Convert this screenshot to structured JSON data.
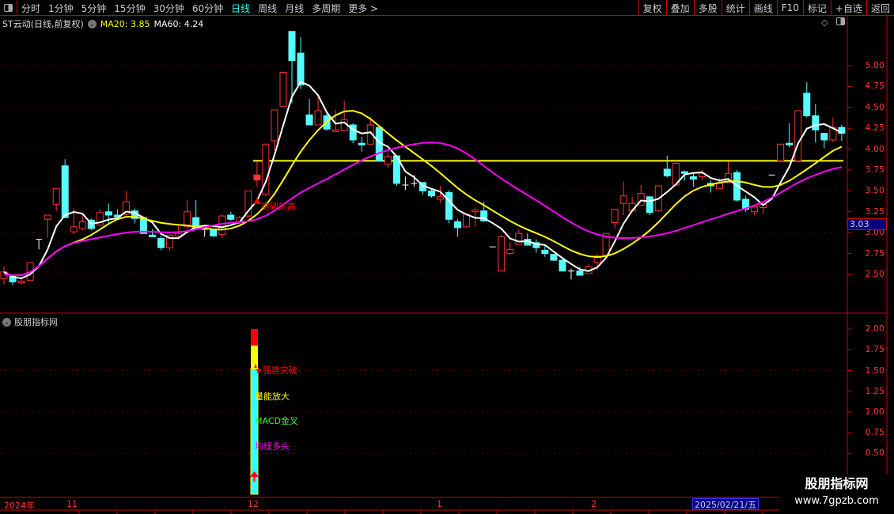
{
  "toolbar": {
    "left": [
      "分时",
      "1分钟",
      "5分钟",
      "15分钟",
      "30分钟",
      "60分钟",
      "日线",
      "周线",
      "月线",
      "多周期",
      "更多 >"
    ],
    "active": "日线",
    "right": [
      "复权",
      "叠加",
      "多股",
      "统计",
      "画线",
      "F10",
      "标记",
      "+自选",
      "返回"
    ]
  },
  "header": {
    "stock": "ST云动(日线,前复权)",
    "ma20_label": "MA20: 3.85",
    "ma60_label": "MA60: 4.24"
  },
  "price_axis": [
    "5.00",
    "4.75",
    "4.50",
    "4.25",
    "4.00",
    "3.75",
    "3.50",
    "3.25",
    "3.00",
    "2.75",
    "2.50"
  ],
  "current_price": "3.03",
  "annotation": "突破前高",
  "indicator": {
    "title": "股朋指标网",
    "axis": [
      "2.00",
      "1.75",
      "1.50",
      "1.25",
      "1.00",
      "0.75",
      "0.50"
    ],
    "signals": [
      "★强势突破",
      "量能放大",
      "MACD金叉",
      "均线多头"
    ],
    "bar_value": 2.0
  },
  "time_axis": {
    "labels": [
      "2024年",
      "11",
      "12",
      "1",
      "2"
    ],
    "selected_date": "2025/02/21/五"
  },
  "watermark": {
    "name": "股朋指标网",
    "url": "www.7gpzb.com"
  },
  "colors": {
    "up": "#ff3333",
    "down": "#55ffff",
    "ma_fast": "#ffffff",
    "ma_mid": "#ffff00",
    "ma_slow": "#ff00ff",
    "grid": "#990000"
  },
  "chart_data": {
    "type": "candlestick",
    "resistance_line": 3.86,
    "candles": [
      [
        2.45,
        2.6,
        2.38,
        2.53
      ],
      [
        2.48,
        2.49,
        2.37,
        2.41
      ],
      [
        2.4,
        2.45,
        2.38,
        2.42
      ],
      [
        2.43,
        2.64,
        2.43,
        2.64
      ],
      [
        2.92,
        2.92,
        2.8,
        2.92
      ],
      [
        3.16,
        3.21,
        2.94,
        3.21
      ],
      [
        3.34,
        3.53,
        3.26,
        3.53
      ],
      [
        3.8,
        3.88,
        3.18,
        3.18
      ],
      [
        3.01,
        3.29,
        2.99,
        3.07
      ],
      [
        3.05,
        3.22,
        3.03,
        3.13
      ],
      [
        3.15,
        3.17,
        3.03,
        3.05
      ],
      [
        3.09,
        3.28,
        3.08,
        3.24
      ],
      [
        3.25,
        3.35,
        3.12,
        3.21
      ],
      [
        3.21,
        3.28,
        3.17,
        3.19
      ],
      [
        3.22,
        3.5,
        3.2,
        3.37
      ],
      [
        3.26,
        3.29,
        3.11,
        3.17
      ],
      [
        3.18,
        3.18,
        2.99,
        2.99
      ],
      [
        2.97,
        3.04,
        2.95,
        2.96
      ],
      [
        2.93,
        2.96,
        2.79,
        2.82
      ],
      [
        2.82,
        2.98,
        2.79,
        2.97
      ],
      [
        2.96,
        3.08,
        2.92,
        2.99
      ],
      [
        3.07,
        3.39,
        3.05,
        3.25
      ],
      [
        3.18,
        3.39,
        3.05,
        3.06
      ],
      [
        3.04,
        3.07,
        2.95,
        3.04
      ],
      [
        3.04,
        3.05,
        2.95,
        2.96
      ],
      [
        2.98,
        3.22,
        2.93,
        3.2
      ],
      [
        3.21,
        3.25,
        3.14,
        3.16
      ],
      [
        3.12,
        3.2,
        3.1,
        3.18
      ],
      [
        3.2,
        3.5,
        3.18,
        3.5
      ],
      [
        3.63,
        3.85,
        3.55,
        3.69
      ],
      [
        3.46,
        4.06,
        3.44,
        4.06
      ],
      [
        4.1,
        4.47,
        3.98,
        4.47
      ],
      [
        4.51,
        4.92,
        4.51,
        4.92
      ],
      [
        5.41,
        5.41,
        4.55,
        5.06
      ],
      [
        5.15,
        5.34,
        4.72,
        4.77
      ],
      [
        4.41,
        4.6,
        4.29,
        4.29
      ],
      [
        4.29,
        4.65,
        4.29,
        4.46
      ],
      [
        4.4,
        4.45,
        4.22,
        4.24
      ],
      [
        4.22,
        4.47,
        4.22,
        4.23
      ],
      [
        4.22,
        4.58,
        4.22,
        4.35
      ],
      [
        4.29,
        4.31,
        4.07,
        4.11
      ],
      [
        4.07,
        4.15,
        3.97,
        4.06
      ],
      [
        4.06,
        4.38,
        4.06,
        4.29
      ],
      [
        4.26,
        4.26,
        3.86,
        3.86
      ],
      [
        3.82,
        3.95,
        3.77,
        3.91
      ],
      [
        3.92,
        3.92,
        3.56,
        3.59
      ],
      [
        3.57,
        3.67,
        3.51,
        3.57
      ],
      [
        3.59,
        3.69,
        3.55,
        3.59
      ],
      [
        3.6,
        3.6,
        3.45,
        3.5
      ],
      [
        3.5,
        3.52,
        3.42,
        3.44
      ],
      [
        3.4,
        3.56,
        3.36,
        3.43
      ],
      [
        3.48,
        3.51,
        3.11,
        3.16
      ],
      [
        3.13,
        3.16,
        2.95,
        3.06
      ],
      [
        3.07,
        3.22,
        3.06,
        3.22
      ],
      [
        3.25,
        3.3,
        3.07,
        3.27
      ],
      [
        3.26,
        3.37,
        3.13,
        3.14
      ],
      [
        2.83,
        2.83,
        2.83,
        2.83
      ],
      [
        2.54,
        2.97,
        2.54,
        2.95
      ],
      [
        2.75,
        2.89,
        2.73,
        2.8
      ],
      [
        2.86,
        3.04,
        2.86,
        2.99
      ],
      [
        2.92,
        2.99,
        2.85,
        2.85
      ],
      [
        2.88,
        2.92,
        2.76,
        2.82
      ],
      [
        2.79,
        2.85,
        2.71,
        2.75
      ],
      [
        2.74,
        2.74,
        2.66,
        2.67
      ],
      [
        2.67,
        2.71,
        2.54,
        2.54
      ],
      [
        2.54,
        2.57,
        2.44,
        2.54
      ],
      [
        2.54,
        2.59,
        2.49,
        2.49
      ],
      [
        2.51,
        2.62,
        2.51,
        2.59
      ],
      [
        2.64,
        2.75,
        2.55,
        2.72
      ],
      [
        2.73,
        2.99,
        2.73,
        2.99
      ],
      [
        3.12,
        3.28,
        3.05,
        3.28
      ],
      [
        3.35,
        3.61,
        3.21,
        3.44
      ],
      [
        3.26,
        3.43,
        3.26,
        3.35
      ],
      [
        3.33,
        3.57,
        3.33,
        3.47
      ],
      [
        3.43,
        3.43,
        3.21,
        3.24
      ],
      [
        3.26,
        3.56,
        3.25,
        3.56
      ],
      [
        3.76,
        3.92,
        3.66,
        3.68
      ],
      [
        3.57,
        3.86,
        3.57,
        3.83
      ],
      [
        3.73,
        3.74,
        3.62,
        3.71
      ],
      [
        3.67,
        3.71,
        3.55,
        3.64
      ],
      [
        3.67,
        3.75,
        3.63,
        3.71
      ],
      [
        3.59,
        3.63,
        3.48,
        3.56
      ],
      [
        3.53,
        3.65,
        3.52,
        3.59
      ],
      [
        3.6,
        3.85,
        3.6,
        3.71
      ],
      [
        3.72,
        3.75,
        3.37,
        3.39
      ],
      [
        3.4,
        3.44,
        3.25,
        3.28
      ],
      [
        3.25,
        3.31,
        3.21,
        3.31
      ],
      [
        3.3,
        3.34,
        3.22,
        3.34
      ],
      [
        3.69,
        3.69,
        3.69,
        3.69
      ],
      [
        3.86,
        4.06,
        3.86,
        4.06
      ],
      [
        4.07,
        4.31,
        4.02,
        4.06
      ],
      [
        3.86,
        4.46,
        3.86,
        4.46
      ],
      [
        4.67,
        4.8,
        4.38,
        4.4
      ],
      [
        4.4,
        4.54,
        4.08,
        4.23
      ],
      [
        4.19,
        4.19,
        4.01,
        4.11
      ],
      [
        4.11,
        4.38,
        4.08,
        4.26
      ],
      [
        4.26,
        4.29,
        4.1,
        4.19
      ]
    ]
  }
}
